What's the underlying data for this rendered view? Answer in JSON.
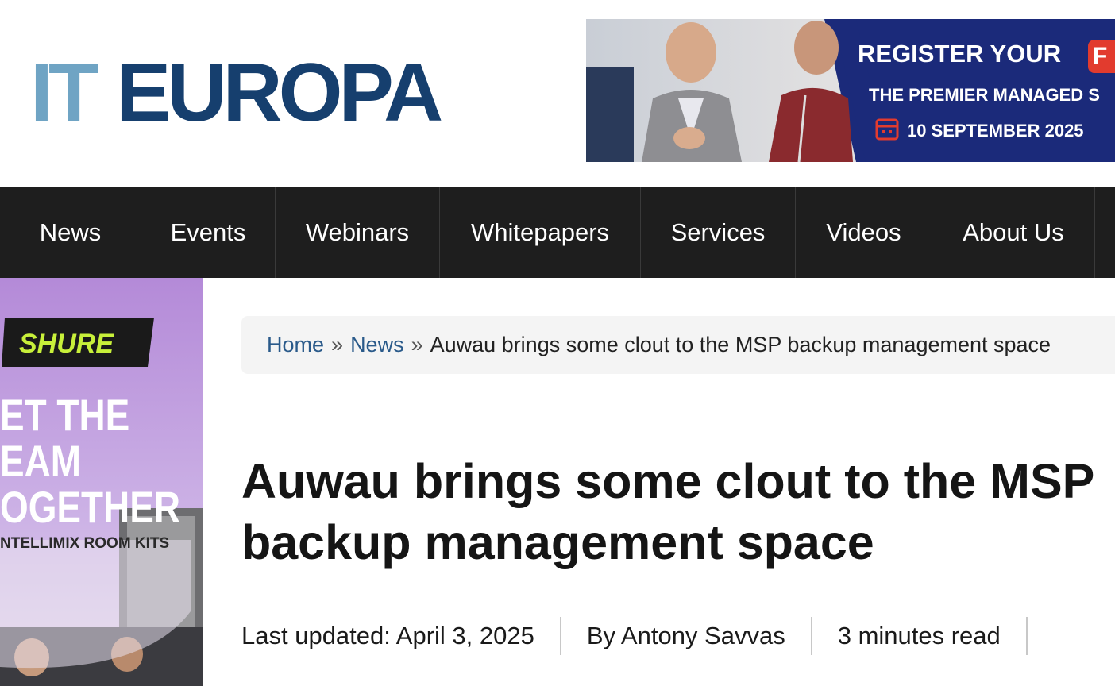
{
  "site": {
    "logo_part1": "IT",
    "logo_part2": "EUROPA",
    "logo_color_light": "#6fa4c4",
    "logo_color_dark": "#163f6e"
  },
  "banner": {
    "line1": "REGISTER YOUR",
    "line1_tag": "F",
    "line2": "THE PREMIER MANAGED S",
    "line3": "10 SEPTEMBER 2025",
    "bg_color": "#1b2a7a"
  },
  "nav": {
    "items": [
      "News",
      "Events",
      "Webinars",
      "Whitepapers",
      "Services",
      "Videos",
      "About Us"
    ]
  },
  "side_ad": {
    "brand": "SHURE",
    "line1": "ET THE",
    "line2": "EAM",
    "line3": "OGETHER",
    "line4": "NTELLIMIX ROOM KITS"
  },
  "breadcrumb": {
    "home": "Home",
    "sep1": "»",
    "news": "News",
    "sep2": "»",
    "current": "Auwau brings some clout to the MSP backup management space"
  },
  "article": {
    "title": "Auwau brings some clout to the MSP backup management space",
    "last_updated": "Last updated: April 3, 2025",
    "author": "By Antony Savvas",
    "read_time": "3 minutes read"
  }
}
